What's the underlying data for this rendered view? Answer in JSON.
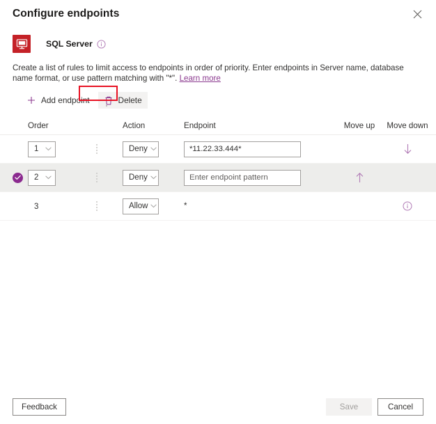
{
  "header": {
    "title": "Configure endpoints",
    "close_label": "Close"
  },
  "resource": {
    "name": "SQL Server",
    "icon_label": "SQL",
    "info_tooltip": "info-icon"
  },
  "description": {
    "text_before_link": "Create a list of rules to limit access to endpoints in order of priority. Enter endpoints in Server name, database name format, or use pattern matching with \"*\". ",
    "link_label": "Learn more"
  },
  "toolbar": {
    "add_label": "Add endpoint",
    "delete_label": "Delete",
    "highlight_color": "#e81123"
  },
  "table": {
    "columns": {
      "order": "Order",
      "action": "Action",
      "endpoint": "Endpoint",
      "move_up": "Move up",
      "move_down": "Move down"
    },
    "rows": [
      {
        "selected": false,
        "order": "1",
        "action": "Deny",
        "endpoint_value": "*11.22.33.444*",
        "endpoint_placeholder": "Enter endpoint pattern",
        "move_up": "",
        "move_down": "↓",
        "has_info": false
      },
      {
        "selected": true,
        "order": "2",
        "action": "Deny",
        "endpoint_value": "",
        "endpoint_placeholder": "Enter endpoint pattern",
        "move_up": "↑",
        "move_down": "",
        "has_info": false
      },
      {
        "selected": false,
        "order": "3",
        "action": "Allow",
        "endpoint_value": "*",
        "endpoint_placeholder": "",
        "move_up": "",
        "move_down": "",
        "has_info": true
      }
    ]
  },
  "footer": {
    "feedback_label": "Feedback",
    "save_label": "Save",
    "cancel_label": "Cancel",
    "save_disabled": true
  },
  "colors": {
    "accent": "#8b3a8f",
    "resource_icon_bg": "#c42127",
    "arrow": "#b07ab5",
    "selected_row_bg": "#ededeb"
  }
}
